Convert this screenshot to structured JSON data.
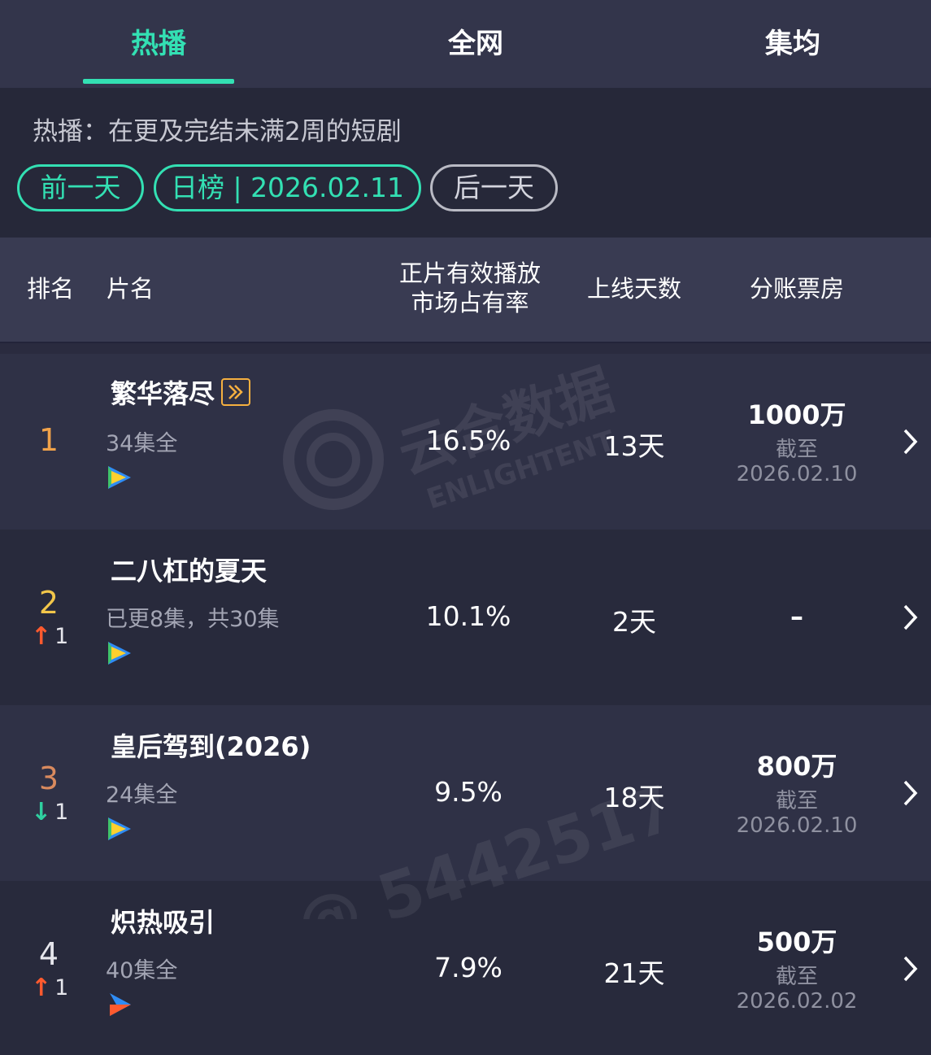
{
  "tabs": [
    {
      "label": "热播",
      "active": true
    },
    {
      "label": "全网",
      "active": false
    },
    {
      "label": "集均",
      "active": false
    }
  ],
  "filter": {
    "description": "热播：在更及完结未满2周的短剧",
    "prev_label": "前一天",
    "current_label": "日榜 | 2026.02.11",
    "next_label": "后一天"
  },
  "header": {
    "rank": "排名",
    "name": "片名",
    "share_line1": "正片有效播放",
    "share_line2": "市场占有率",
    "days": "上线天数",
    "boxoffice": "分账票房"
  },
  "rows": [
    {
      "rank": "1",
      "rank_color": "#f0a24a",
      "change": "",
      "change_dir": "",
      "title": "繁华落尽",
      "badge_icon": "fast-forward-badge-icon",
      "episodes": "34集全",
      "platform_icon": "tencent-video-icon",
      "share": "16.5%",
      "days": "13天",
      "boxoffice": "1000万",
      "as_of_label": "截至",
      "as_of_date": "2026.02.10"
    },
    {
      "rank": "2",
      "rank_color": "#f2c64a",
      "change": "1",
      "change_dir": "up",
      "title": "二八杠的夏天",
      "badge_icon": "",
      "episodes": "已更8集，共30集",
      "platform_icon": "tencent-video-icon",
      "share": "10.1%",
      "days": "2天",
      "boxoffice": "–",
      "as_of_label": "",
      "as_of_date": ""
    },
    {
      "rank": "3",
      "rank_color": "#d98a5e",
      "change": "1",
      "change_dir": "down",
      "title": "皇后驾到(2026)",
      "badge_icon": "",
      "episodes": "24集全",
      "platform_icon": "tencent-video-icon",
      "share": "9.5%",
      "days": "18天",
      "boxoffice": "800万",
      "as_of_label": "截至",
      "as_of_date": "2026.02.10"
    },
    {
      "rank": "4",
      "rank_color": "#e6e6ec",
      "change": "1",
      "change_dir": "up",
      "title": "炽热吸引",
      "badge_icon": "",
      "episodes": "40集全",
      "platform_icon": "youku-icon",
      "share": "7.9%",
      "days": "21天",
      "boxoffice": "500万",
      "as_of_label": "截至",
      "as_of_date": "2026.02.02"
    }
  ],
  "watermark": {
    "brand": "云合数据",
    "brand_en": "ENLIGHTENT",
    "user_id": "@ 54425174"
  },
  "colors": {
    "accent": "#33e0b3",
    "up": "#ff5a2e",
    "down": "#2fd0a0"
  }
}
